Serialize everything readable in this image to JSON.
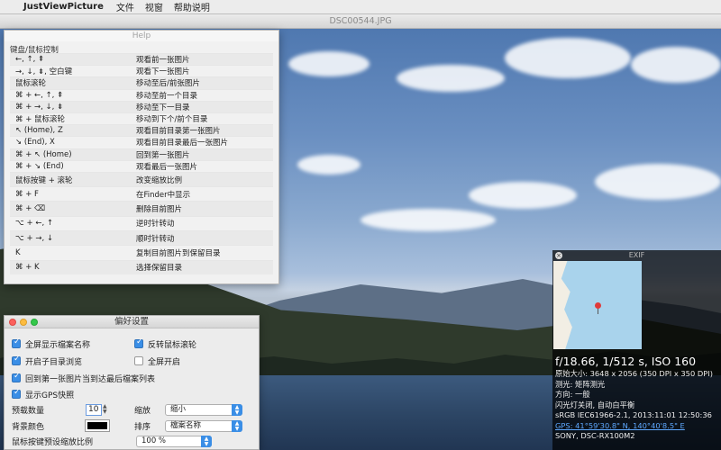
{
  "menubar": {
    "apple_icon": "apple-logo",
    "app_name": "JustViewPicture",
    "items": [
      "文件",
      "视窗",
      "帮助说明"
    ]
  },
  "main_window": {
    "title": "DSC00544.JPG"
  },
  "help_window": {
    "title": "Help",
    "heading": "键盘/鼠标控制",
    "rows": [
      {
        "key": "←, ↑, ⇞",
        "desc": "观看前一张图片"
      },
      {
        "key": "→, ↓, ⇟, 空白键",
        "desc": "观看下一张图片"
      },
      {
        "key": "鼠标滚轮",
        "desc": "移动至后/前张图片"
      },
      {
        "key": "⌘ + ←, ↑, ⇞",
        "desc": "移动至前一个目录"
      },
      {
        "key": "⌘ + →, ↓, ⇟",
        "desc": "移动至下一目录"
      },
      {
        "key": "⌘ + 鼠标滚轮",
        "desc": "移动到下个/前个目录"
      },
      {
        "key": "↖ (Home), Z",
        "desc": "观看目前目录第一张图片"
      },
      {
        "key": "↘ (End), X",
        "desc": "观看目前目录最后一张图片"
      },
      {
        "key": "⌘ + ↖ (Home)",
        "desc": "回到第一张图片"
      },
      {
        "key": "⌘ + ↘ (End)",
        "desc": "观看最后一张图片"
      },
      {
        "key": "鼠标按键 + 滚轮",
        "desc": "改变缩放比例"
      },
      {
        "key": "⌘ + F",
        "desc": "在Finder中显示"
      },
      {
        "key": "⌘ + ⌫",
        "desc": "删除目前图片"
      },
      {
        "key": "⌥ + ←, ↑",
        "desc": "逆时针转动"
      },
      {
        "key": "⌥ + →, ↓",
        "desc": "顺时针转动"
      },
      {
        "key": "K",
        "desc": "复制目前图片到保留目录"
      },
      {
        "key": "⌘ + K",
        "desc": "选择保留目录"
      }
    ]
  },
  "prefs_window": {
    "title": "偏好设置",
    "fullscreen_filename": {
      "label": "全屏显示檔案名称",
      "checked": true
    },
    "reverse_wheel": {
      "label": "反转鼠标滚轮",
      "checked": true
    },
    "open_dir_browse": {
      "label": "开启子目录浏览",
      "checked": true
    },
    "fullscreen_start": {
      "label": "全屏开启",
      "checked": false
    },
    "wrap_list": {
      "label": "回到第一张图片当到达最后檔案列表",
      "checked": true
    },
    "show_gps": {
      "label": "显示GPS快照",
      "checked": true
    },
    "preload_label": "预载数量",
    "preload_value": "10",
    "zoom_label": "缩放",
    "zoom_value": "缩小",
    "bg_color_label": "背景颜色",
    "bg_color": "#000000",
    "sort_label": "排序",
    "sort_value": "檔案名称",
    "mouse_zoom_label": "鼠标按键预设缩放比例",
    "mouse_zoom_value": "100 %"
  },
  "exif_panel": {
    "title": "EXIF",
    "exposure": "f/18.66, 1/512 s, ISO 160",
    "lines": [
      "原始大小: 3648 x 2056 (350 DPI x 350 DPI)",
      "测光: 矩阵测光",
      "方向: 一般",
      "闪光灯关闭, 自动白平衡",
      "sRGB IEC61966-2.1, 2013:11:01 12:50:36"
    ],
    "gps": "GPS: 41°59'30.8\" N, 140°40'8.5\" E",
    "camera": "SONY, DSC-RX100M2"
  }
}
